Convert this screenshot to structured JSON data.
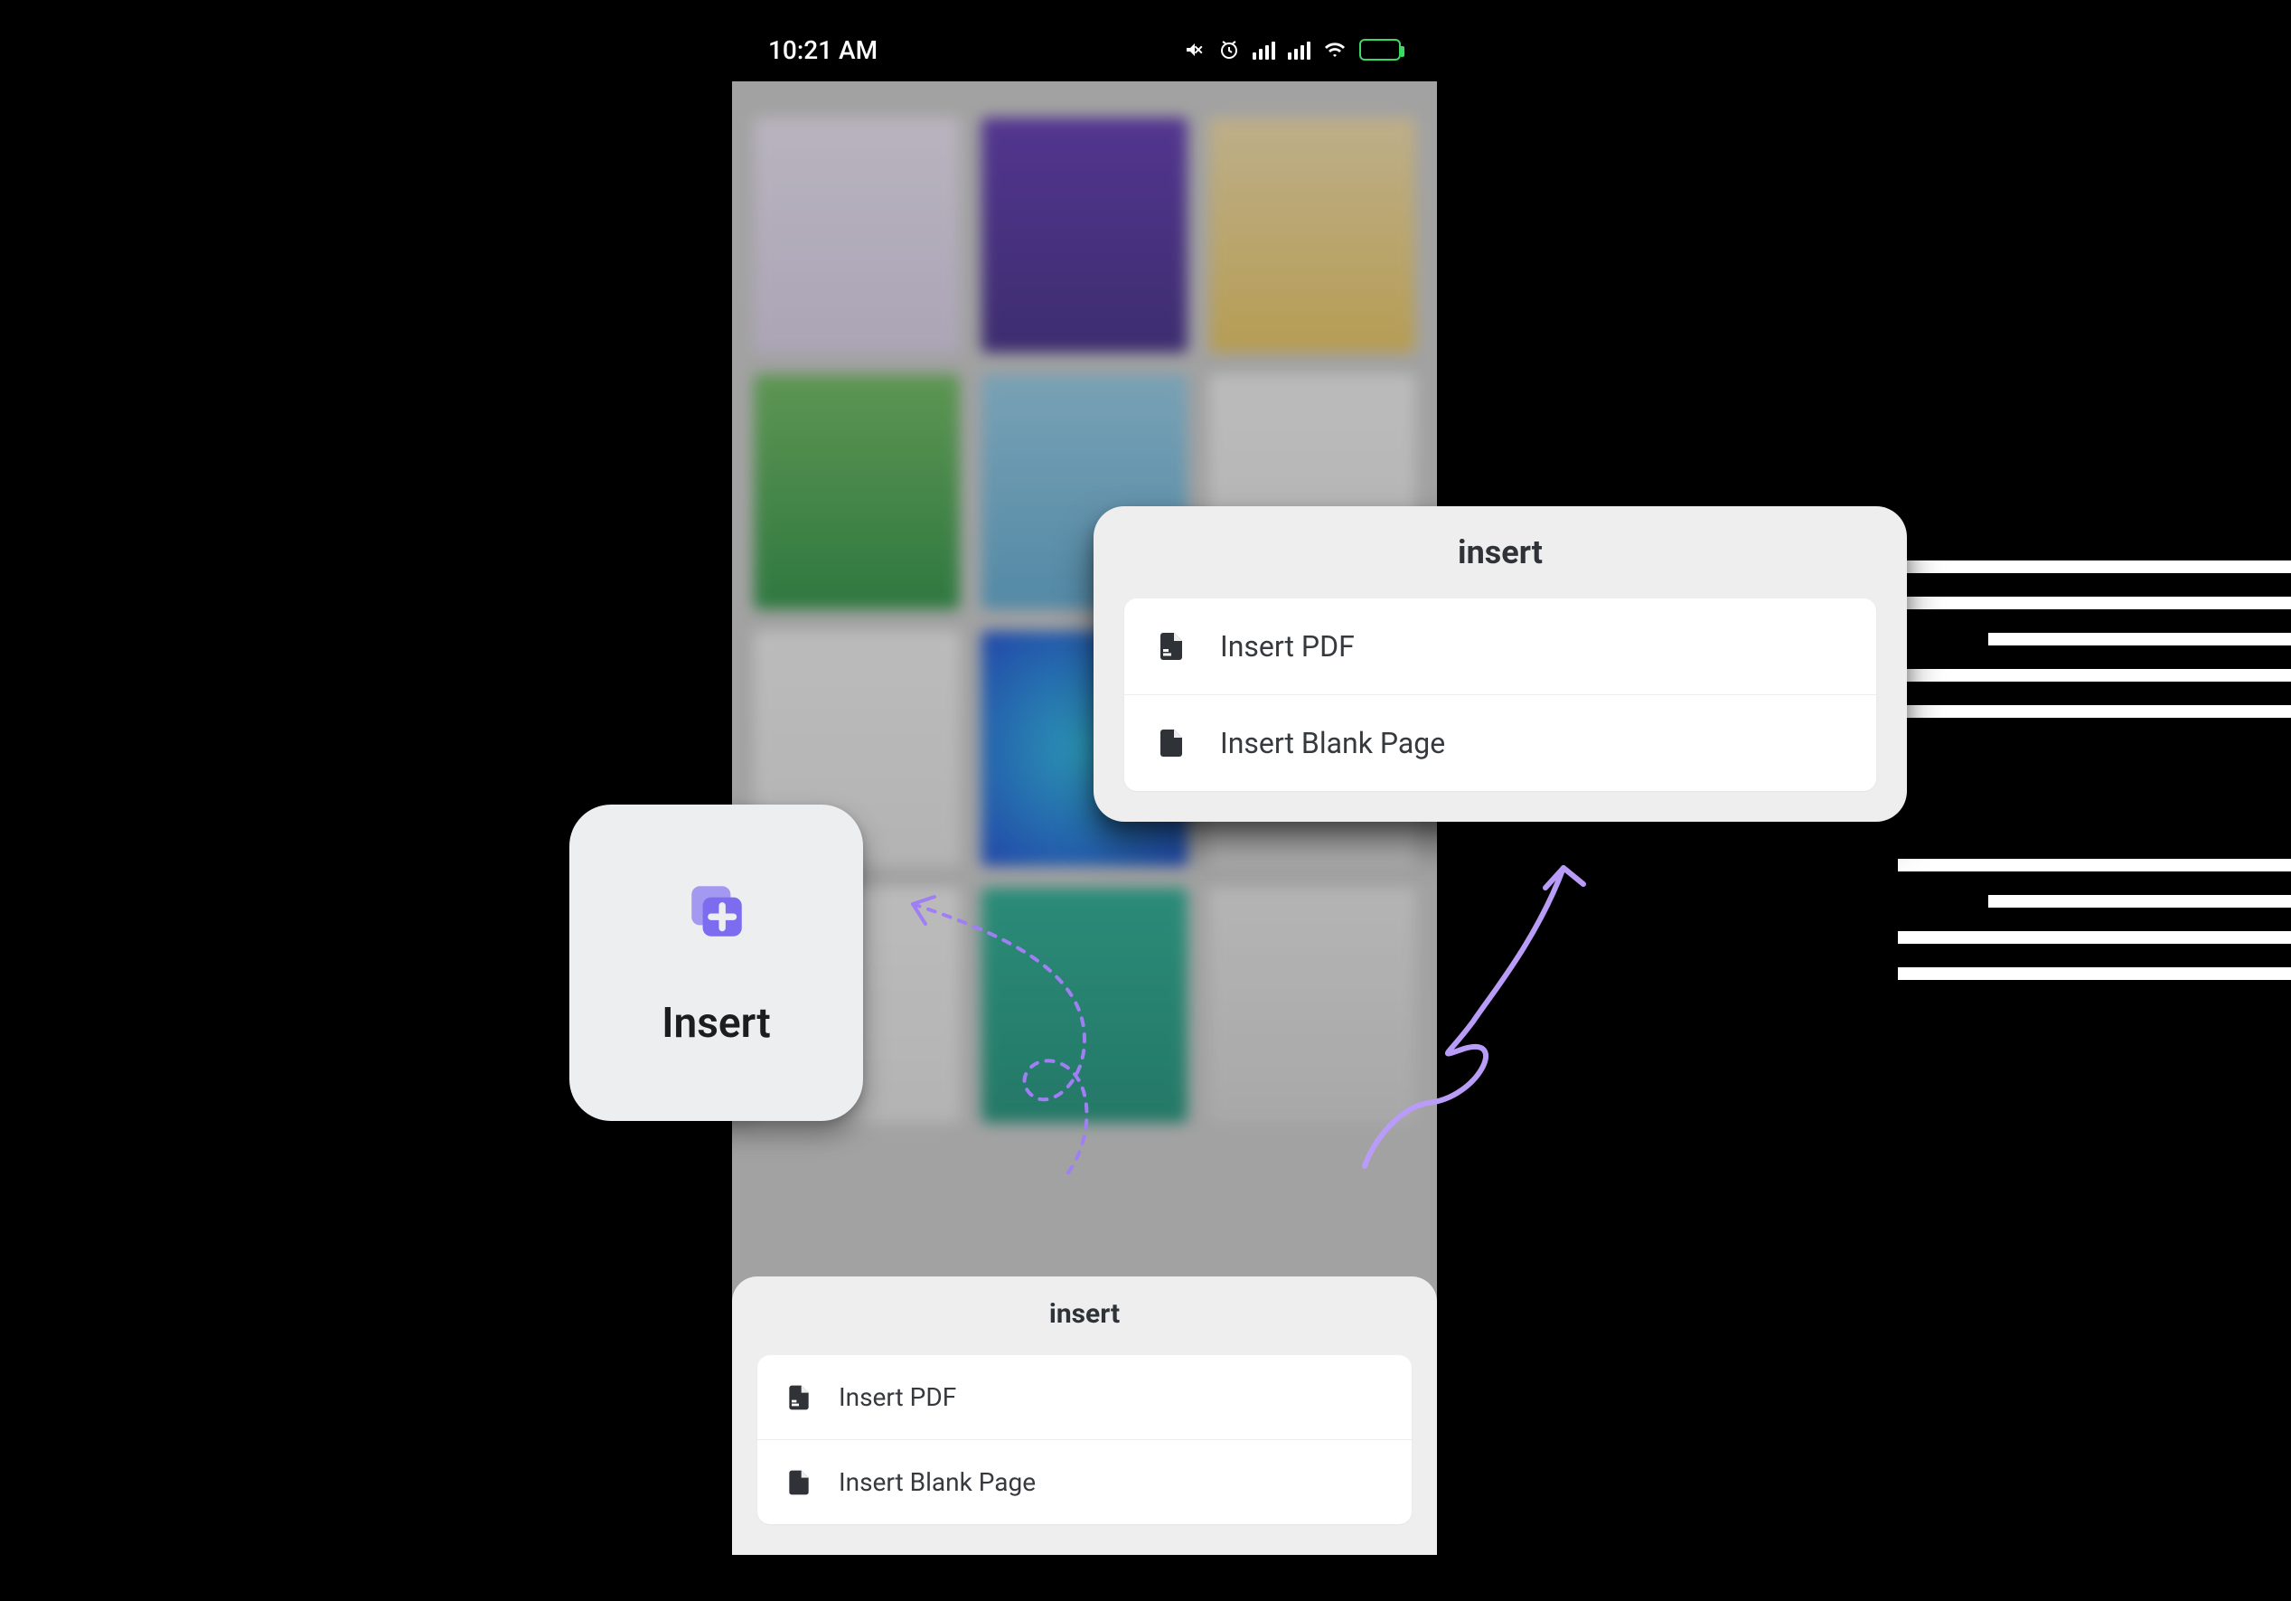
{
  "statusbar": {
    "time": "10:21 AM"
  },
  "tile": {
    "label": "Insert"
  },
  "sheet": {
    "title": "insert",
    "items": [
      {
        "label": "Insert PDF"
      },
      {
        "label": "Insert Blank Page"
      }
    ]
  },
  "panel": {
    "title": "insert",
    "items": [
      {
        "label": "Insert PDF"
      },
      {
        "label": "Insert Blank Page"
      }
    ]
  }
}
